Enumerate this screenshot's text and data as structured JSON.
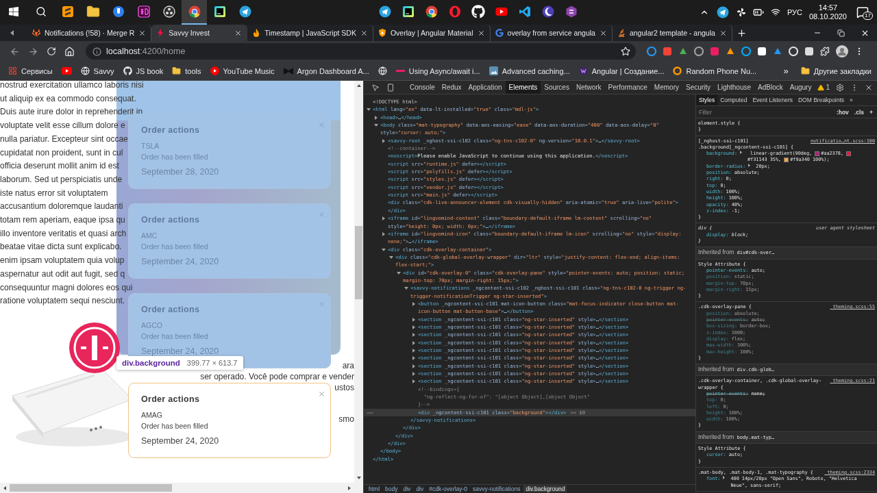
{
  "taskbar": {
    "apps": [
      {
        "selected": false
      },
      {
        "selected": false
      },
      {
        "selected": false
      },
      {
        "selected": false
      },
      {
        "selected": false
      },
      {
        "selected": true
      },
      {
        "selected": false
      },
      {
        "selected": false
      }
    ],
    "tray": {
      "language": "РУС",
      "time": "14:57",
      "date": "08.10.2020",
      "notifications": "17"
    }
  },
  "browser": {
    "tabs": [
      {
        "title": "Notifications (!58) · Merge R",
        "selected": false
      },
      {
        "title": "Savvy Invest",
        "selected": true
      },
      {
        "title": "Timestamp | JavaScript SDK",
        "selected": false
      },
      {
        "title": "Overlay | Angular Material",
        "selected": false
      },
      {
        "title": "overlay from service angula",
        "selected": false
      },
      {
        "title": "angular2 template - angula",
        "selected": false
      }
    ],
    "address": {
      "host": "localhost",
      "path": ":4200/home"
    },
    "bookmarks": [
      {
        "kind": "link",
        "label": "Сервисы"
      },
      {
        "kind": "icon"
      },
      {
        "kind": "link",
        "label": "Savvy"
      },
      {
        "kind": "link",
        "label": "JS book"
      },
      {
        "kind": "link",
        "label": "tools"
      },
      {
        "kind": "link",
        "label": "YouTube Music"
      },
      {
        "kind": "link",
        "label": "Argon Dashboard A..."
      },
      {
        "kind": "icon"
      },
      {
        "kind": "link",
        "label": "Using Async/await i..."
      },
      {
        "kind": "link",
        "label": "Advanced caching..."
      },
      {
        "kind": "link",
        "label": "Angular | Создание..."
      },
      {
        "kind": "link",
        "label": "Random Phone Nu..."
      }
    ],
    "bookmarks_more": "»",
    "other_bookmarks": "Другие закладки"
  },
  "page": {
    "lorem_lines": [
      "nostrud exercitation ullamco laboris nisi",
      "ut aliquip ex ea commodo consequat.",
      "Duis aute irure dolor in reprehenderit in",
      "voluptate velit esse cillum dolore e",
      "nulla pariatur. Excepteur sint occae",
      "cupidatat non proident, sunt in cul",
      "officia deserunt mollit anim id est",
      "laborum. Sed ut perspiciatis unde",
      "iste natus error sit voluptatem",
      "accusantium doloremque laudanti",
      "totam rem aperiam, eaque ipsa qu",
      "illo inventore veritatis et quasi arch",
      "beatae vitae dicta sunt explicabo.",
      "enim ipsam voluptatem quia volup",
      "aspernatur aut odit aut fugit, sed q",
      "consequuntur magni dolores eos qui",
      "ratione voluptatem sequi nesciunt."
    ],
    "side_text": [
      [
        "ara",
        "ser operado. Você pode comprar e vender",
        "ustos"
      ],
      [
        "smo"
      ]
    ],
    "notifications": [
      {
        "highlighted": true,
        "title": "Order actions",
        "ticker": "TSLA",
        "status": "Order has been filled",
        "date": "September 28, 2020"
      },
      {
        "highlighted": true,
        "title": "Order actions",
        "ticker": "AMC",
        "status": "Order has been filled",
        "date": "September 24, 2020"
      },
      {
        "highlighted": true,
        "title": "Order actions",
        "ticker": "AGCO",
        "status": "Order has been filled",
        "date": "September 24, 2020"
      },
      {
        "highlighted": false,
        "title": "Order actions",
        "ticker": "AMAG",
        "status": "Order has been filled",
        "date": "September 24, 2020"
      }
    ],
    "inspector_tooltip": {
      "element": "div.background",
      "size": "399.77 × 613.7"
    }
  },
  "devtools": {
    "tabs": [
      {
        "label": "Console",
        "selected": false
      },
      {
        "label": "Redux",
        "selected": false
      },
      {
        "label": "Application",
        "selected": false
      },
      {
        "label": "Elements",
        "selected": true
      },
      {
        "label": "Sources",
        "selected": false
      },
      {
        "label": "Network",
        "selected": false
      },
      {
        "label": "Performance",
        "selected": false
      },
      {
        "label": "Memory",
        "selected": false
      },
      {
        "label": "Security",
        "selected": false
      },
      {
        "label": "Lighthouse",
        "selected": false
      },
      {
        "label": "AdBlock",
        "selected": false
      },
      {
        "label": "Augury",
        "selected": false
      }
    ],
    "warnings": "1",
    "dom_tree": [
      {
        "kind": "doctype",
        "markup": "<!DOCTYPE html>",
        "selected": false
      },
      {
        "kind": "element",
        "markup": "<html lang=\"en\" data-lt-installed=\"true\" class=\"mdl-js\">",
        "expanded": true,
        "selected": false,
        "close": "</html>",
        "children": [
          {
            "kind": "element",
            "markup": "<head>…</head>",
            "expanded": false,
            "selected": false
          },
          {
            "kind": "element",
            "markup": "<body class=\"mat-typography\" data-aos-easing=\"ease\" data-aos-duration=\"400\" data-aos-delay=\"0\" style=\"cursor: auto;\">",
            "expanded": true,
            "selected": false,
            "close": "</body>",
            "children": [
              {
                "kind": "element",
                "markup": "<savvy-root _nghost-ssi-c102 class=\"ng-tns-c102-0\" ng-version=\"10.0.1\">…</savvy-root>",
                "expanded": false,
                "selected": false
              },
              {
                "kind": "comment",
                "markup": "<!--container-->",
                "selected": false
              },
              {
                "kind": "element",
                "markup": "<noscript>Please enable JavaScript to continue using this application.</noscript>",
                "selected": false
              },
              {
                "kind": "element",
                "markup": "<script src=\"runtime.js\" defer></script>",
                "selected": false
              },
              {
                "kind": "element",
                "markup": "<script src=\"polyfills.js\" defer></script>",
                "selected": false
              },
              {
                "kind": "element",
                "markup": "<script src=\"styles.js\" defer></script>",
                "selected": false
              },
              {
                "kind": "element",
                "markup": "<script src=\"vendor.js\" defer></script>",
                "selected": false
              },
              {
                "kind": "element",
                "markup": "<script src=\"main.js\" defer></script>",
                "selected": false
              },
              {
                "kind": "element",
                "markup": "<div class=\"cdk-live-announcer-element cdk-visually-hidden\" aria-atomic=\"true\" aria-live=\"polite\"></div>",
                "selected": false
              },
              {
                "kind": "element",
                "markup": "<iframe id=\"lingvomind-content\" class=\"boundary-default-iframe lm-content\" scrolling=\"no\" style=\"height: 0px; width: 0px;\">…</iframe>",
                "expanded": false,
                "selected": false
              },
              {
                "kind": "element",
                "markup": "<iframe id=\"lingvomind-icon\" class=\"boundary-default-iframe lm-icon\" scrolling=\"no\" style=\"display: none;\">…</iframe>",
                "expanded": false,
                "selected": false
              },
              {
                "kind": "element",
                "markup": "<div class=\"cdk-overlay-container\">",
                "expanded": true,
                "selected": false,
                "close": "</div>",
                "children": [
                  {
                    "kind": "element",
                    "markup": "<div class=\"cdk-global-overlay-wrapper\" dir=\"ltr\" style=\"justify-content: flex-end; align-items: flex-start;\">",
                    "expanded": true,
                    "selected": false,
                    "close": "</div>",
                    "children": [
                      {
                        "kind": "element",
                        "markup": "<div id=\"cdk-overlay-0\" class=\"cdk-overlay-pane\" style=\"pointer-events: auto; position: static; margin-top: 70px; margin-right: 15px;\">",
                        "expanded": true,
                        "selected": false,
                        "close": "</div>",
                        "children": [
                          {
                            "kind": "element",
                            "markup": "<savvy-notifications _ngcontent-ssi-c102 _nghost-ssi-c101 class=\"ng-tns-c102-0 ng-trigger ng-trigger-notificationTrigger ng-star-inserted\">",
                            "expanded": true,
                            "selected": false,
                            "close": "</savvy-notifications>",
                            "children": [
                              {
                                "kind": "element",
                                "markup": "<button _ngcontent-ssi-c101 mat-icon-button class=\"mat-focus-indicator close-button mat-icon-button mat-button-base\">…</button>",
                                "expanded": false,
                                "selected": false
                              },
                              {
                                "kind": "element",
                                "markup": "<section _ngcontent-ssi-c101 class=\"ng-star-inserted\" style>…</section>",
                                "expanded": false,
                                "selected": false
                              },
                              {
                                "kind": "element",
                                "markup": "<section _ngcontent-ssi-c101 class=\"ng-star-inserted\" style>…</section>",
                                "expanded": false,
                                "selected": false
                              },
                              {
                                "kind": "element",
                                "markup": "<section _ngcontent-ssi-c101 class=\"ng-star-inserted\" style>…</section>",
                                "expanded": false,
                                "selected": false
                              },
                              {
                                "kind": "element",
                                "markup": "<section _ngcontent-ssi-c101 class=\"ng-star-inserted\" style>…</section>",
                                "expanded": false,
                                "selected": false
                              },
                              {
                                "kind": "element",
                                "markup": "<section _ngcontent-ssi-c101 class=\"ng-star-inserted\" style>…</section>",
                                "expanded": false,
                                "selected": false
                              },
                              {
                                "kind": "element",
                                "markup": "<section _ngcontent-ssi-c101 class=\"ng-star-inserted\" style>…</section>",
                                "expanded": false,
                                "selected": false
                              },
                              {
                                "kind": "element",
                                "markup": "<section _ngcontent-ssi-c101 class=\"ng-star-inserted\" style>…</section>",
                                "expanded": false,
                                "selected": false
                              },
                              {
                                "kind": "element",
                                "markup": "<section _ngcontent-ssi-c101 class=\"ng-star-inserted\" style>…</section>",
                                "expanded": false,
                                "selected": false
                              },
                              {
                                "kind": "element",
                                "markup": "<section _ngcontent-ssi-c101 class=\"ng-star-inserted\" style>…</section>",
                                "expanded": false,
                                "selected": false
                              },
                              {
                                "kind": "comment",
                                "markup": "<!--bindings={\n  \"ng-reflect-ng-for-of\": \"[object Object],[object Object\"\n}-->",
                                "selected": false
                              },
                              {
                                "kind": "element",
                                "markup": "<div _ngcontent-ssi-c101 class=\"background\"></div>",
                                "selected": true,
                                "console_ref": "== $0"
                              }
                            ]
                          }
                        ]
                      }
                    ]
                  }
                ]
              }
            ]
          }
        ]
      }
    ],
    "breadcrumbs": [
      {
        "label": "html",
        "selected": false
      },
      {
        "label": "body",
        "selected": false
      },
      {
        "label": "div",
        "selected": false
      },
      {
        "label": "div",
        "selected": false
      },
      {
        "label": "#cdk-overlay-0",
        "selected": false
      },
      {
        "label": "savvy-notifications",
        "selected": false
      },
      {
        "label": "div.background",
        "selected": true
      }
    ],
    "styles": {
      "tabs": [
        {
          "label": "Styles",
          "selected": true
        },
        {
          "label": "Computed",
          "selected": false
        },
        {
          "label": "Event Listeners",
          "selected": false
        },
        {
          "label": "DOM Breakpoints",
          "selected": false
        }
      ],
      "more": "»",
      "filter_placeholder": "Filter",
      "hov": ":hov",
      "cls": ".cls",
      "add": "+",
      "rules": [
        {
          "kind": "rule",
          "user_agent": false,
          "selector": "element.style {",
          "close": "}"
        },
        {
          "kind": "rule",
          "user_agent": false,
          "selector": "[_nghost-ssi-c101]\n.background[_ngcontent-ssi-c101] {",
          "source": "notificatio…nt.scss:100",
          "close": "}",
          "props": [
            {
              "text": "background: linear-gradient(90deg, #aa2378, #f31143 35%, #f9a340 100%);",
              "expandable": true,
              "dimmed": false,
              "struck": false
            },
            {
              "text": "border-radius: 20px;",
              "expandable": true,
              "dimmed": false,
              "struck": false
            },
            {
              "text": "position: absolute;",
              "expandable": false,
              "dimmed": false,
              "struck": false
            },
            {
              "text": "right: 0;",
              "expandable": false,
              "dimmed": false,
              "struck": false
            },
            {
              "text": "top: 0;",
              "expandable": false,
              "dimmed": false,
              "struck": false
            },
            {
              "text": "width: 100%;",
              "expandable": false,
              "dimmed": false,
              "struck": false
            },
            {
              "text": "height: 100%;",
              "expandable": false,
              "dimmed": false,
              "struck": false
            },
            {
              "text": "opacity: 40%;",
              "expandable": false,
              "dimmed": false,
              "struck": false
            },
            {
              "text": "z-index: -1;",
              "expandable": false,
              "dimmed": false,
              "struck": false
            }
          ]
        },
        {
          "kind": "rule",
          "user_agent": true,
          "selector": "div {",
          "source": "user agent stylesheet",
          "close": "}",
          "props": [
            {
              "text": "display: block;",
              "expandable": false,
              "dimmed": false,
              "struck": false
            }
          ]
        },
        {
          "kind": "inherited",
          "label": "Inherited from",
          "target": "div#cdk-over…"
        },
        {
          "kind": "rule",
          "user_agent": false,
          "selector": "Style Attribute {",
          "close": "}",
          "props": [
            {
              "text": "pointer-events: auto;",
              "expandable": false,
              "dimmed": false,
              "struck": false
            },
            {
              "text": "position: static;",
              "expandable": false,
              "dimmed": true,
              "struck": false
            },
            {
              "text": "margin-top: 70px;",
              "expandable": false,
              "dimmed": true,
              "struck": false
            },
            {
              "text": "margin-right: 15px;",
              "expandable": false,
              "dimmed": true,
              "struck": false
            }
          ]
        },
        {
          "kind": "rule",
          "user_agent": false,
          "selector": ".cdk-overlay-pane {",
          "source": "_theming.scss:55",
          "close": "}",
          "props": [
            {
              "text": "position: absolute;",
              "expandable": false,
              "dimmed": true,
              "struck": false
            },
            {
              "text": "pointer-events: auto;",
              "expandable": false,
              "dimmed": true,
              "struck": true
            },
            {
              "text": "box-sizing: border-box;",
              "expandable": false,
              "dimmed": true,
              "struck": false
            },
            {
              "text": "z-index: 1000;",
              "expandable": false,
              "dimmed": true,
              "struck": false
            },
            {
              "text": "display: flex;",
              "expandable": false,
              "dimmed": true,
              "struck": false
            },
            {
              "text": "max-width: 100%;",
              "expandable": false,
              "dimmed": true,
              "struck": false
            },
            {
              "text": "max-height: 100%;",
              "expandable": false,
              "dimmed": true,
              "struck": false
            }
          ]
        },
        {
          "kind": "inherited",
          "label": "Inherited from",
          "target": "div.cdk-glob…"
        },
        {
          "kind": "rule",
          "user_agent": false,
          "selector": ".cdk-overlay-container, .cdk-global-overlay-wrapper {",
          "source": "_theming.scss:21",
          "close": "}",
          "props": [
            {
              "text": "pointer-events: none;",
              "expandable": false,
              "dimmed": false,
              "struck": true
            },
            {
              "text": "top: 0;",
              "expandable": false,
              "dimmed": true,
              "struck": false
            },
            {
              "text": "left: 0;",
              "expandable": false,
              "dimmed": true,
              "struck": false
            },
            {
              "text": "height: 100%;",
              "expandable": false,
              "dimmed": true,
              "struck": false
            },
            {
              "text": "width: 100%;",
              "expandable": false,
              "dimmed": true,
              "struck": false
            }
          ]
        },
        {
          "kind": "inherited",
          "label": "Inherited from",
          "target": "body.mat-typ…"
        },
        {
          "kind": "rule",
          "user_agent": false,
          "selector": "Style Attribute {",
          "close": "}",
          "props": [
            {
              "text": "cursor: auto;",
              "expandable": false,
              "dimmed": false,
              "struck": false
            }
          ]
        },
        {
          "kind": "rule",
          "user_agent": false,
          "selector": ".mat-body, .mat-body-1, .mat-typography {",
          "source": "_theming.scss:2334",
          "props": [
            {
              "text": "font: 400 14px/20px \"Open Sans\", Roboto, \"Helvetica Neue\", sans-serif;",
              "expandable": true,
              "dimmed": false,
              "struck": false
            }
          ]
        }
      ]
    }
  }
}
